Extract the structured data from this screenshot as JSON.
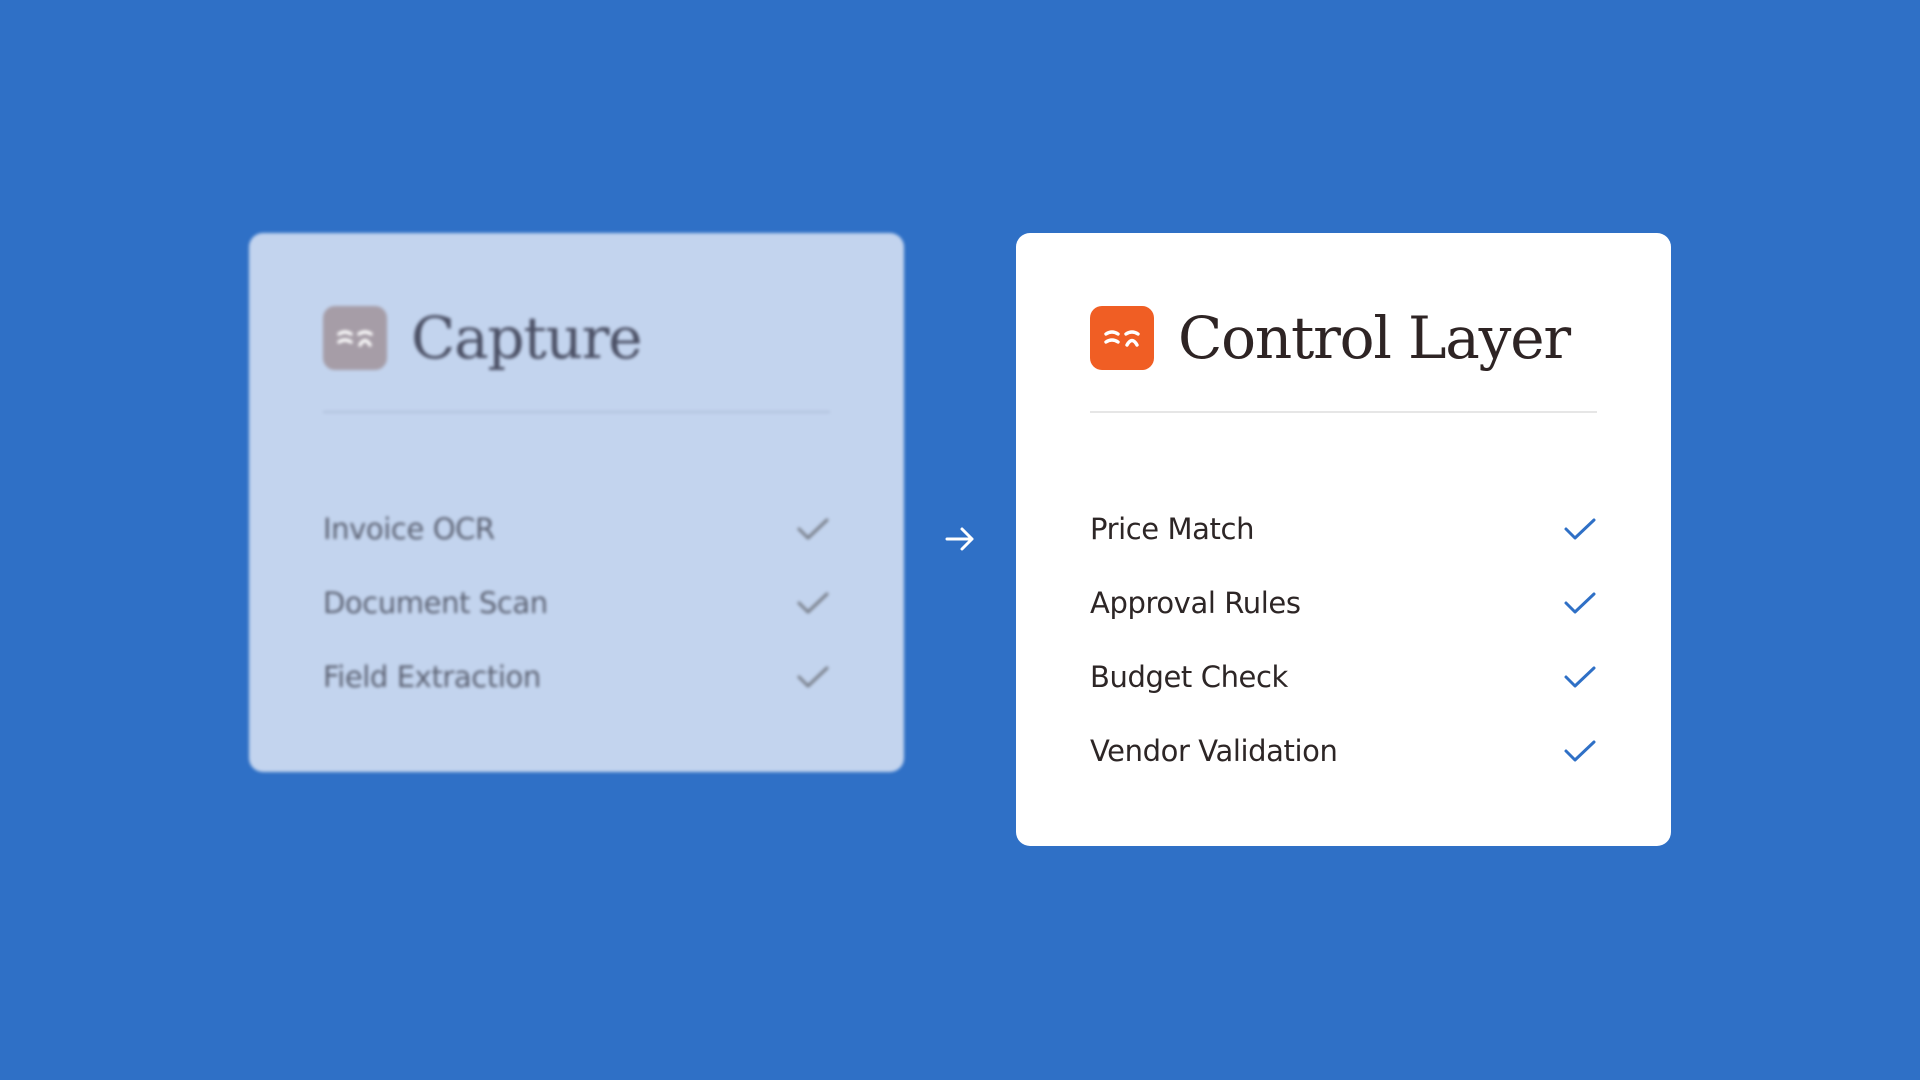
{
  "colors": {
    "background": "#2F70C6",
    "brand_orange": "#F05E24",
    "check_blue": "#2F70C6",
    "muted_card": "#C3D4EE"
  },
  "capture_card": {
    "logo_icon": "brand-wave-icon",
    "title": "Capture",
    "state": "blurred",
    "features": [
      {
        "label": "Invoice OCR",
        "icon": "check-icon"
      },
      {
        "label": "Document Scan",
        "icon": "check-icon"
      },
      {
        "label": "Field Extraction",
        "icon": "check-icon"
      }
    ]
  },
  "flow_arrow_icon": "arrow-right-icon",
  "control_layer_card": {
    "logo_icon": "brand-wave-icon",
    "title": "Control Layer",
    "features": [
      {
        "label": "Price Match",
        "icon": "check-icon"
      },
      {
        "label": "Approval Rules",
        "icon": "check-icon"
      },
      {
        "label": "Budget Check",
        "icon": "check-icon"
      },
      {
        "label": "Vendor Validation",
        "icon": "check-icon"
      }
    ]
  }
}
